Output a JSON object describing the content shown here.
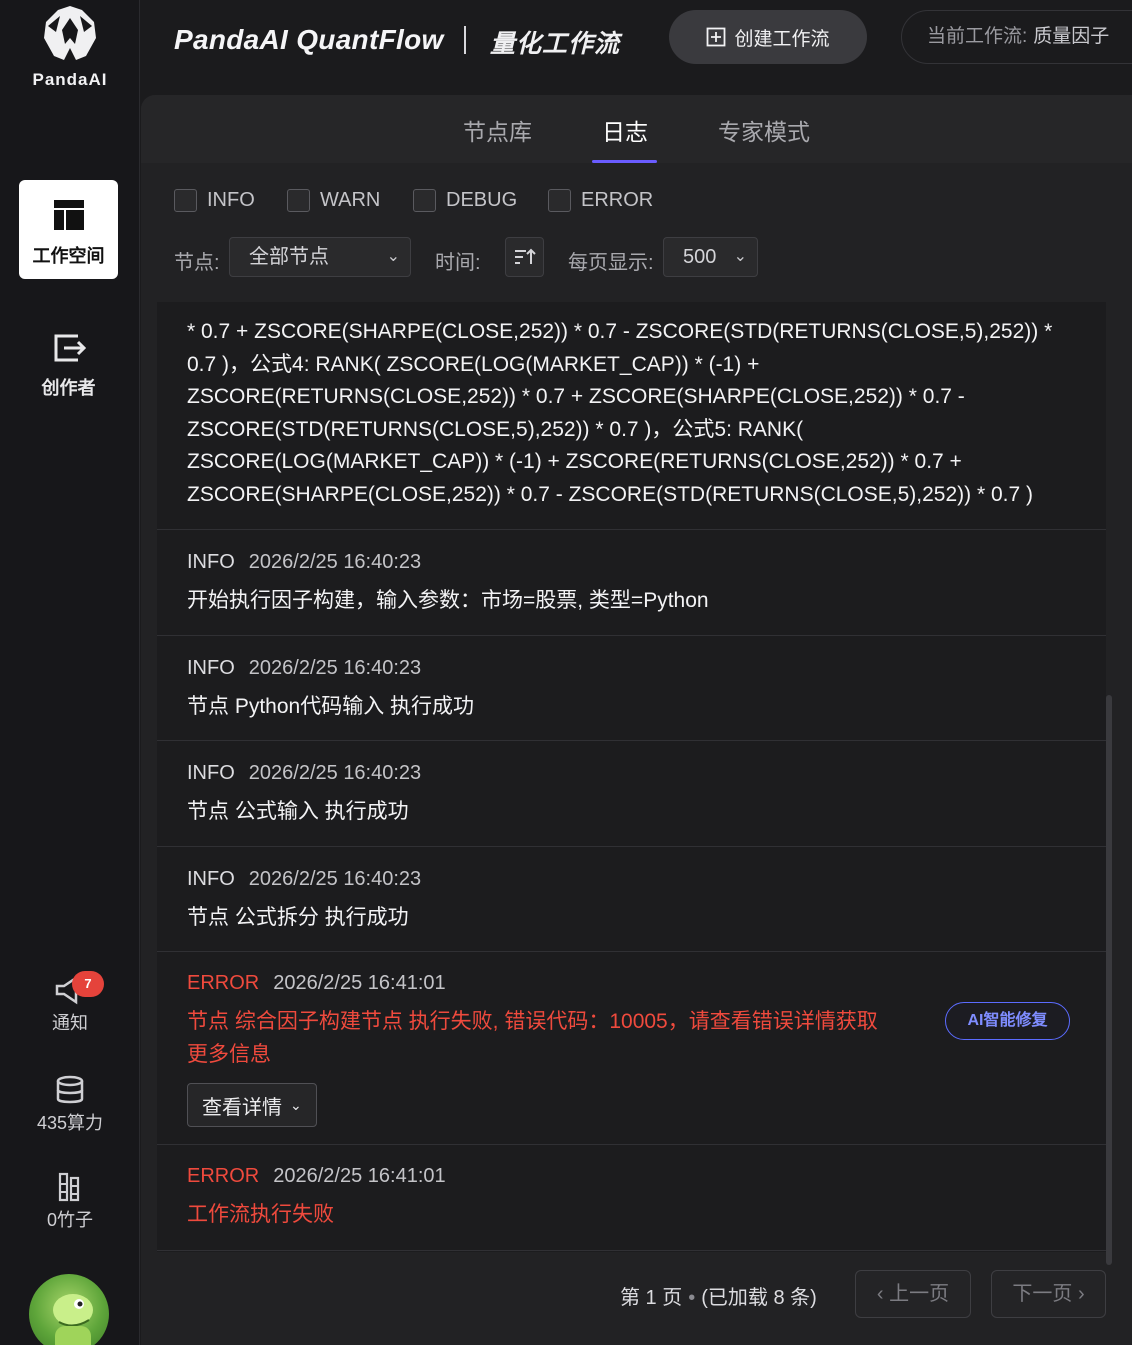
{
  "brand": {
    "name": "PandaAI"
  },
  "rail": {
    "workspace_label": "工作空间",
    "creator_label": "创作者",
    "notify_label": "通知",
    "notify_count": "7",
    "compute_label": "435算力",
    "bamboo_label": "0竹子"
  },
  "header": {
    "app_title": "PandaAI QuantFlow",
    "app_subtitle": "量化工作流",
    "create_label": "创建工作流",
    "current_label": "当前工作流:",
    "current_value": "质量因子"
  },
  "tabs": [
    {
      "label": "节点库",
      "active": false
    },
    {
      "label": "日志",
      "active": true
    },
    {
      "label": "专家模式",
      "active": false
    }
  ],
  "filters": {
    "levels": [
      "INFO",
      "WARN",
      "DEBUG",
      "ERROR"
    ],
    "node_label": "节点:",
    "node_value": "全部节点",
    "time_label": "时间:",
    "page_size_label": "每页显示:",
    "page_size_value": "500"
  },
  "log": {
    "continued": "* 0.7 + ZSCORE(SHARPE(CLOSE,252)) * 0.7 - ZSCORE(STD(RETURNS(CLOSE,5),252)) * 0.7 )，公式4: RANK( ZSCORE(LOG(MARKET_CAP)) * (-1) + ZSCORE(RETURNS(CLOSE,252)) * 0.7 + ZSCORE(SHARPE(CLOSE,252)) * 0.7 - ZSCORE(STD(RETURNS(CLOSE,5),252)) * 0.7 )，公式5: RANK( ZSCORE(LOG(MARKET_CAP)) * (-1) + ZSCORE(RETURNS(CLOSE,252)) * 0.7 + ZSCORE(SHARPE(CLOSE,252)) * 0.7 - ZSCORE(STD(RETURNS(CLOSE,5),252)) * 0.7 )",
    "entries": [
      {
        "level": "INFO",
        "time": "2026/2/25 16:40:23",
        "message": "开始执行因子构建，输入参数：市场=股票, 类型=Python"
      },
      {
        "level": "INFO",
        "time": "2026/2/25 16:40:23",
        "message": "节点 Python代码输入 执行成功"
      },
      {
        "level": "INFO",
        "time": "2026/2/25 16:40:23",
        "message": "节点 公式输入 执行成功"
      },
      {
        "level": "INFO",
        "time": "2026/2/25 16:40:23",
        "message": "节点 公式拆分 执行成功"
      },
      {
        "level": "ERROR",
        "time": "2026/2/25 16:41:01",
        "message": "节点 综合因子构建节点 执行失败, 错误代码：10005，请查看错误详情获取更多信息",
        "detail_label": "查看详情",
        "ai_fix_label": "AI智能修复"
      },
      {
        "level": "ERROR",
        "time": "2026/2/25 16:41:01",
        "message": "工作流执行失败"
      }
    ]
  },
  "pager": {
    "page_text": "第 1 页",
    "loaded_text": "(已加载 8 条)",
    "prev_label": "上一页",
    "next_label": "下一页"
  },
  "colors": {
    "accent": "#6a5cff",
    "error": "#ef4a3d",
    "ai_button": "#5b6bff"
  },
  "icons": {
    "brand": "panda-logo-icon",
    "workspace": "layout-icon",
    "creator": "export-icon",
    "notify": "megaphone-icon",
    "compute": "database-icon",
    "bamboo": "bamboo-icon",
    "create": "plus-square-icon",
    "sort": "sort-icon",
    "chevron": "chevron-down-icon"
  }
}
